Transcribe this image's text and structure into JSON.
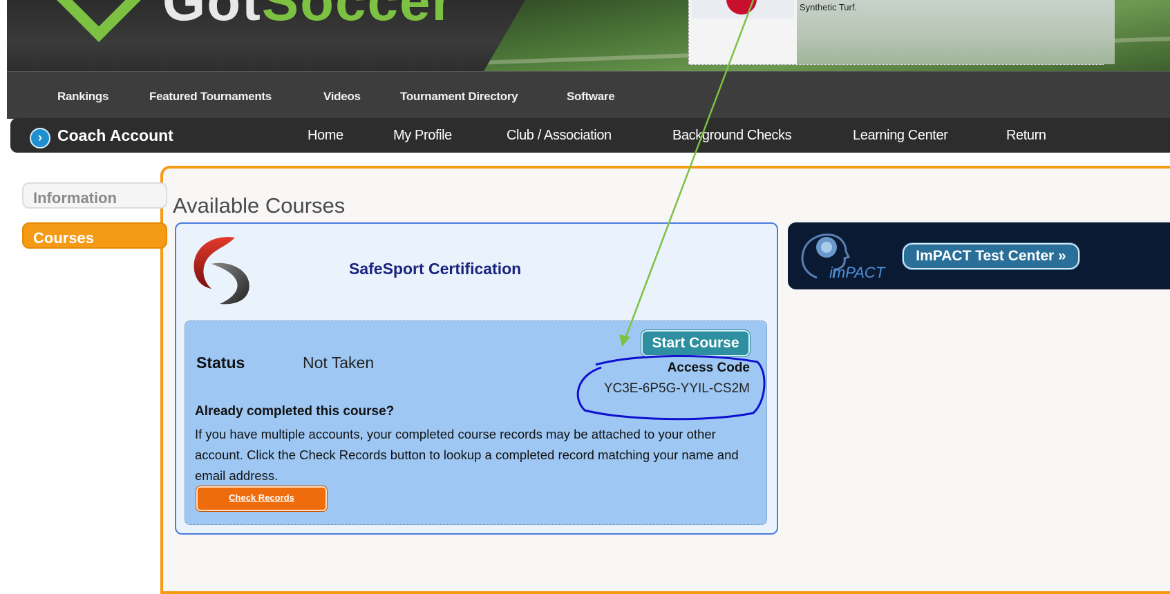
{
  "header": {
    "ad_text": "Synthetic Turf."
  },
  "topnav": {
    "items": [
      "Rankings",
      "Featured Tournaments",
      "Videos",
      "Tournament Directory",
      "Software"
    ]
  },
  "account_bar": {
    "title": "Coach Account",
    "items": [
      "Home",
      "My Profile",
      "Club / Association",
      "Background Checks",
      "Learning Center",
      "Return"
    ]
  },
  "sidebar": {
    "tabs": [
      "Information",
      "Courses"
    ],
    "active": "Courses"
  },
  "main": {
    "title": "Available Courses",
    "course": {
      "title": "SafeSport Certification",
      "status_label": "Status",
      "status_value": "Not Taken",
      "start_button": "Start Course",
      "access_code_label": "Access Code",
      "access_code": "YC3E-6P5G-YYIL-CS2M",
      "already_heading": "Already completed this course?",
      "description": "If you have multiple accounts, your completed course records may be attached to your other account. Click the Check Records button to lookup a completed record matching your name and email address.",
      "check_button": "Check Records"
    },
    "impact": {
      "logo_text": "imPACT",
      "button": "ImPACT Test Center »"
    }
  },
  "colors": {
    "accent_orange": "#f59a14",
    "nav_dark": "#3d3d3d",
    "card_border": "#4a7be0",
    "teal_button": "#2d8f9f",
    "annotation_arrow": "#7cc142",
    "annotation_circle": "#1010d0"
  }
}
